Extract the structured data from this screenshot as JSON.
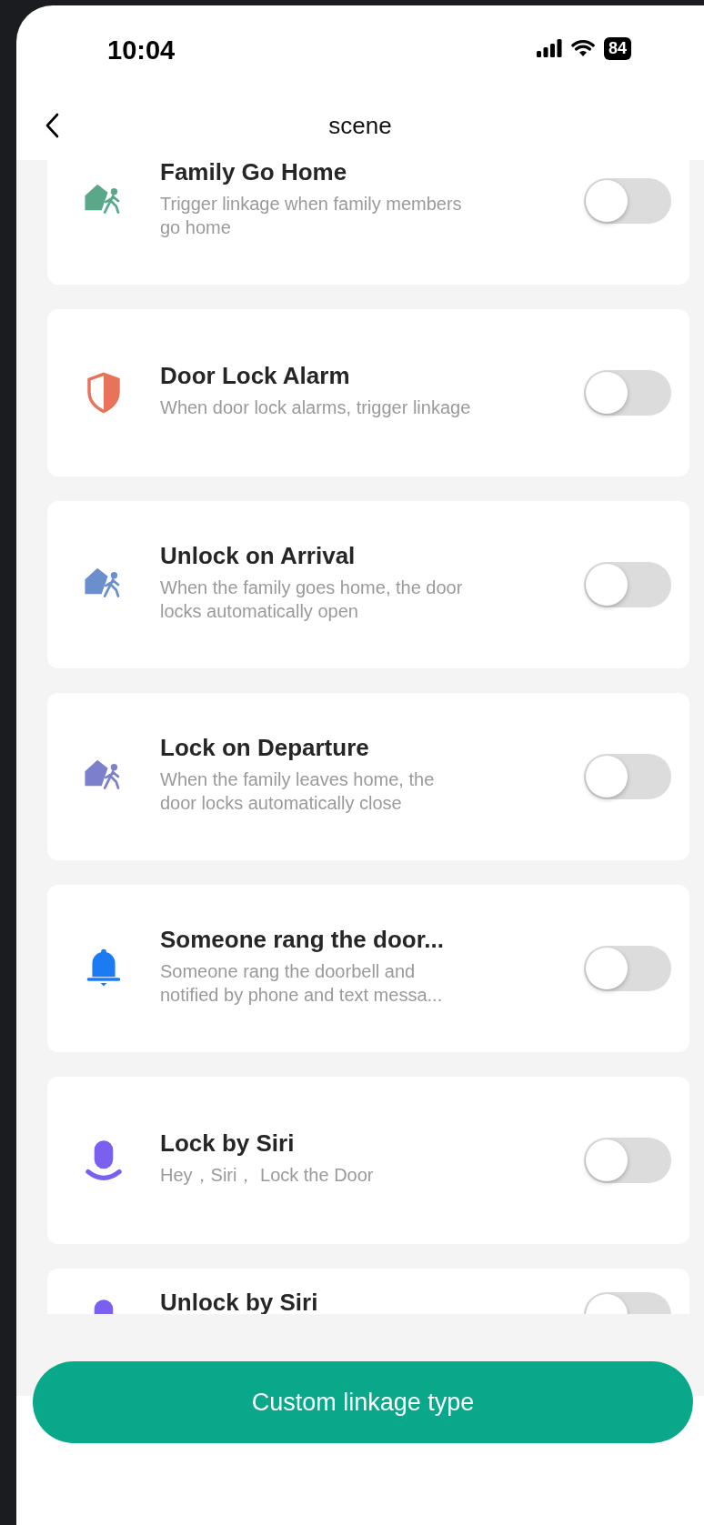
{
  "status_bar": {
    "time": "10:04",
    "battery": "84"
  },
  "nav": {
    "title": "scene"
  },
  "scenes": [
    {
      "title": "Family Go Home",
      "subtitle": "Trigger linkage when family members go home",
      "kind": "house-walker",
      "color": "#5aa88a",
      "on": false
    },
    {
      "title": "Door Lock Alarm",
      "subtitle": "When door lock alarms, trigger linkage",
      "kind": "shield",
      "color": "#e8735a",
      "on": false
    },
    {
      "title": "Unlock on Arrival",
      "subtitle": "When the family goes home, the door locks automatically open",
      "kind": "house-walker",
      "color": "#6a8fcc",
      "on": false
    },
    {
      "title": "Lock on Departure",
      "subtitle": "When the family leaves home, the door locks automatically close",
      "kind": "house-walker",
      "color": "#7c80cc",
      "on": false
    },
    {
      "title": "Someone rang the door...",
      "subtitle": "Someone rang the doorbell and notified by phone and text messa...",
      "kind": "bell",
      "color": "#1a7cf0",
      "on": false
    },
    {
      "title": "Lock by Siri",
      "subtitle": "Hey，Siri，  Lock the Door",
      "kind": "mic",
      "color": "#7a5ff0",
      "on": false
    },
    {
      "title": "Unlock by Siri",
      "kind": "mic",
      "color": "#7a5ff0",
      "on": false
    }
  ],
  "footer": {
    "button": "Custom linkage type"
  }
}
